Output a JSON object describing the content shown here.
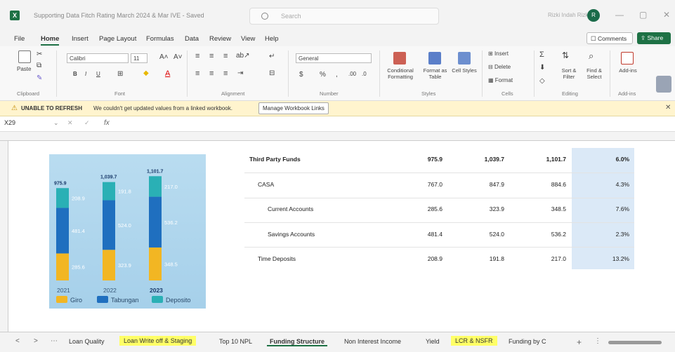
{
  "window": {
    "title": "Supporting Data Fitch Rating March 2024 & Mar IVE - Saved",
    "search_placeholder": "Search",
    "user_name": "Rizki Indah Rizky",
    "user_initial": "R"
  },
  "menu": [
    "File",
    "Home",
    "Insert",
    "Page Layout",
    "Formulas",
    "Data",
    "Review",
    "View",
    "Help"
  ],
  "menu_active": "Home",
  "comments_label": "Comments",
  "share_label": "Share",
  "ribbon": {
    "clipboard": {
      "label": "Clipboard",
      "paste": "Paste"
    },
    "font": {
      "label": "Font",
      "name": "Calibri",
      "size": "11"
    },
    "alignment": {
      "label": "Alignment"
    },
    "number": {
      "label": "Number",
      "format": "General"
    },
    "styles": {
      "label": "Styles",
      "cond": "Conditional Formatting",
      "table": "Format as Table",
      "cell": "Cell Styles"
    },
    "cells": {
      "label": "Cells",
      "insert": "Insert",
      "delete": "Delete",
      "format": "Format"
    },
    "editing": {
      "label": "Editing",
      "sort": "Sort & Filter",
      "find": "Find & Select"
    },
    "addins": {
      "label": "Add-ins",
      "btn": "Add-ins"
    }
  },
  "notify": {
    "title": "UNABLE TO REFRESH",
    "message": "We couldn't get updated values from a linked workbook.",
    "button": "Manage Workbook Links"
  },
  "formula_bar": {
    "cell": "X29",
    "fx": "fx"
  },
  "chart_data": {
    "type": "bar",
    "stacked": true,
    "categories": [
      "2021",
      "2022",
      "2023"
    ],
    "totals": [
      "975.9",
      "1,039.7",
      "1,101.7"
    ],
    "series": [
      {
        "name": "Giro",
        "values": [
          285.6,
          323.9,
          348.5
        ],
        "color": "#f2b623"
      },
      {
        "name": "Tabungan",
        "values": [
          481.4,
          524.0,
          536.2
        ],
        "color": "#1f6fbf"
      },
      {
        "name": "Deposito",
        "values": [
          208.9,
          191.8,
          217.0
        ],
        "color": "#2ab0b5"
      }
    ]
  },
  "table": {
    "rows": [
      {
        "label": "Third Party Funds",
        "v2021": "975.9",
        "v2022": "1,039.7",
        "v2023": "1,101.7",
        "growth": "6.0%",
        "bold": true,
        "indent": 0
      },
      {
        "label": "CASA",
        "v2021": "767.0",
        "v2022": "847.9",
        "v2023": "884.6",
        "growth": "4.3%",
        "bold": false,
        "indent": 1
      },
      {
        "label": "Current Accounts",
        "v2021": "285.6",
        "v2022": "323.9",
        "v2023": "348.5",
        "growth": "7.6%",
        "bold": false,
        "indent": 2
      },
      {
        "label": "Savings Accounts",
        "v2021": "481.4",
        "v2022": "524.0",
        "v2023": "536.2",
        "growth": "2.3%",
        "bold": false,
        "indent": 2
      },
      {
        "label": "Time Deposits",
        "v2021": "208.9",
        "v2022": "191.8",
        "v2023": "217.0",
        "growth": "13.2%",
        "bold": false,
        "indent": 1
      }
    ]
  },
  "sheet_tabs": [
    {
      "label": "Loan Quality",
      "style": "normal"
    },
    {
      "label": "Loan Write off & Staging",
      "style": "yellow"
    },
    {
      "label": "Top 10 NPL",
      "style": "normal"
    },
    {
      "label": "Funding Structure",
      "style": "active"
    },
    {
      "label": "Non Interest Income",
      "style": "normal"
    },
    {
      "label": "Yield",
      "style": "normal"
    },
    {
      "label": "LCR & NSFR",
      "style": "yellow"
    },
    {
      "label": "Funding by C",
      "style": "normal"
    }
  ]
}
